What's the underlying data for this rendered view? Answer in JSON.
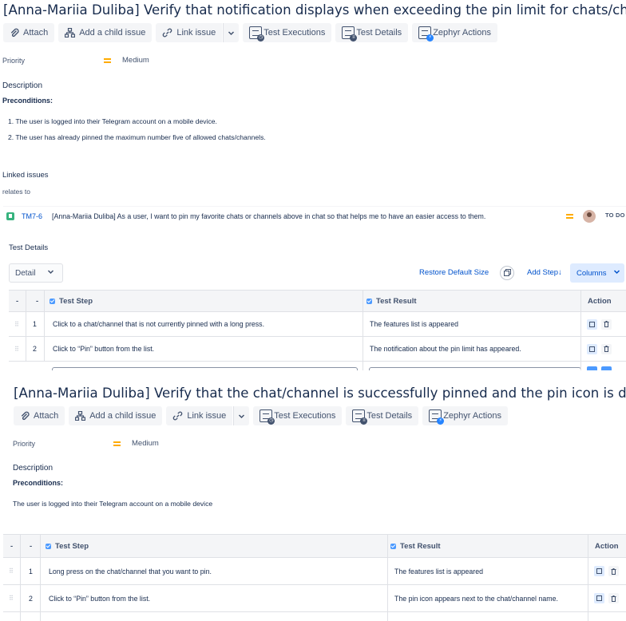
{
  "toolbar": {
    "attach": "Attach",
    "add_child": "Add a child issue",
    "link_issue": "Link issue",
    "test_executions": "Test Executions",
    "test_details": "Test Details",
    "zephyr_actions": "Zephyr Actions"
  },
  "issue1": {
    "title": "[Anna-Mariia Duliba] Verify that notification displays when exceeding the pin limit for chats/channels.",
    "priority_label": "Priority",
    "priority_value": "Medium",
    "description_label": "Description",
    "preconditions_label": "Preconditions:",
    "preconditions": [
      "1. The user is logged into their Telegram account on a mobile device.",
      "2. The user has already pinned the maximum number five of allowed chats/channels."
    ],
    "linked_issues_label": "Linked issues",
    "relates_to_label": "relates to",
    "linked": {
      "key": "TM7-6",
      "summary": "[Anna-Mariia Duliba] As a user, I want to pin my favorite chats or channels above in chat so that helps me to have an easier access to them.",
      "status": "TO DO"
    },
    "test_details_label": "Test Details",
    "view_select": "Detail",
    "restore_default_size": "Restore Default Size",
    "add_step": "Add Step↓",
    "columns": "Columns",
    "table": {
      "col_dash1": "-",
      "col_dash2": "-",
      "col_step": "Test Step",
      "col_result": "Test Result",
      "col_action": "Action",
      "rows": [
        {
          "num": "1",
          "step": "Click to a chat/channel that is not currently pinned with a long press.",
          "result": "The features list is appeared"
        },
        {
          "num": "2",
          "step": "Click to “Pin” button from the list.",
          "result": "The notification about the pin limit has appeared."
        }
      ]
    }
  },
  "issue2": {
    "title": "[Anna-Mariia Duliba] Verify that the chat/channel is successfully pinned and the pin icon is displayed.",
    "priority_label": "Priority",
    "priority_value": "Medium",
    "description_label": "Description",
    "preconditions_label": "Preconditions:",
    "precondition_text": "The user is logged into their Telegram account on a mobile device",
    "table": {
      "col_dash1": "-",
      "col_dash2": "-",
      "col_step": "Test Step",
      "col_result": "Test Result",
      "col_action": "Action",
      "rows": [
        {
          "num": "1",
          "step": "Long press on the chat/channel that you want to pin.",
          "result": "The features list is appeared"
        },
        {
          "num": "2",
          "step": "Click to “Pin” button from the list.",
          "result": "The pin icon appears next to the chat/channel name."
        }
      ]
    }
  },
  "colors": {
    "link": "#0052cc",
    "priority_medium": "#ffab00",
    "story": "#36b37e",
    "checkbox": "#4c9aff"
  }
}
